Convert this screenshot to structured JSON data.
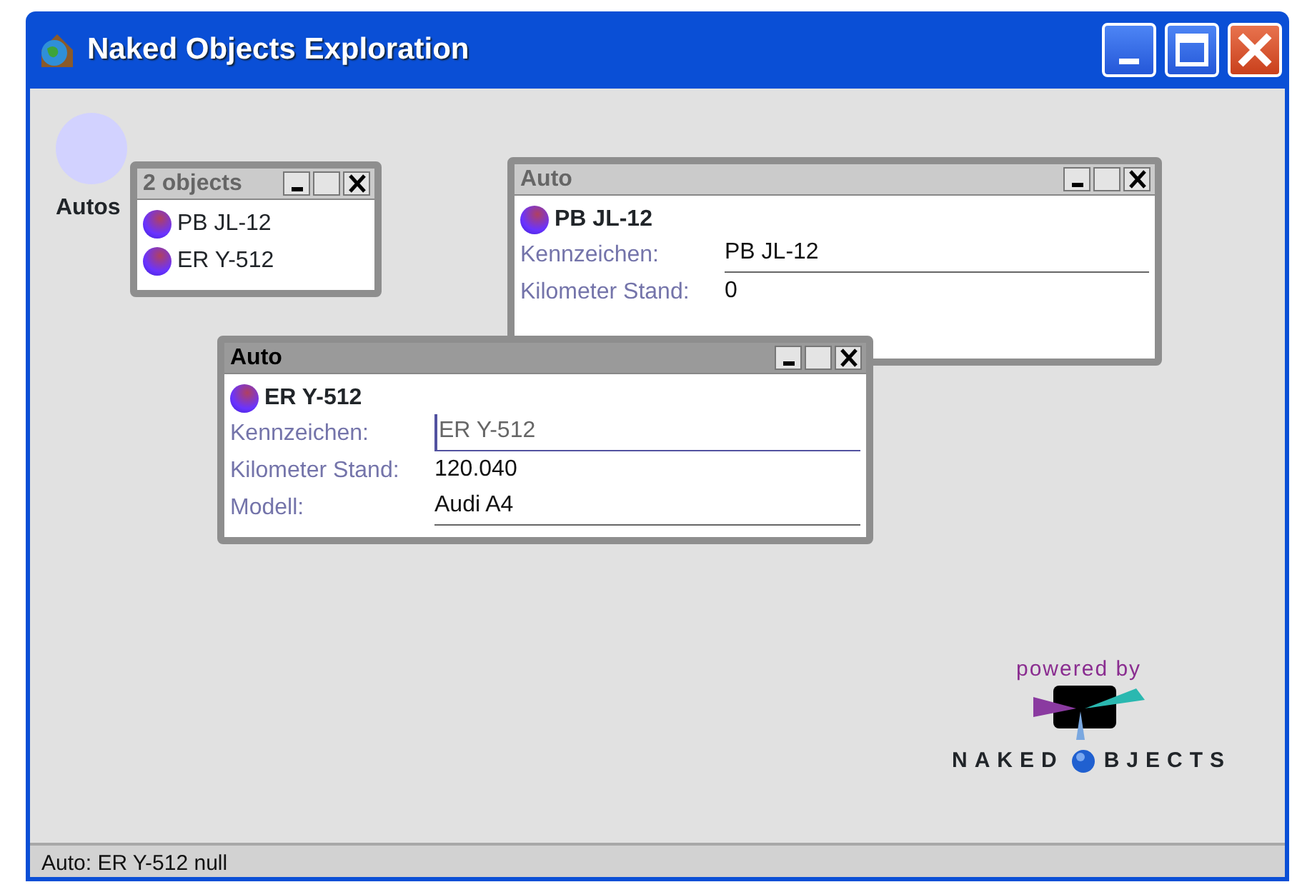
{
  "window": {
    "title": "Naked Objects Exploration"
  },
  "desktop_icon": {
    "label": "Autos"
  },
  "collection_window": {
    "title": "2 objects",
    "active": false,
    "items": [
      {
        "label": "PB JL-12"
      },
      {
        "label": "ER Y-512"
      }
    ]
  },
  "object_windows": [
    {
      "title": "Auto",
      "active": false,
      "heading": "PB JL-12",
      "fields": [
        {
          "label": "Kennzeichen:",
          "value": "PB JL-12",
          "kind": "text",
          "editing": false
        },
        {
          "label": "Kilometer Stand:",
          "value": "0",
          "kind": "number",
          "editing": false
        }
      ]
    },
    {
      "title": "Auto",
      "active": true,
      "heading": "ER Y-512",
      "fields": [
        {
          "label": "Kennzeichen:",
          "value": "ER Y-512",
          "kind": "text",
          "editing": true
        },
        {
          "label": "Kilometer Stand:",
          "value": "120.040",
          "kind": "number",
          "editing": false
        },
        {
          "label": "Modell:",
          "value": "Audi A4",
          "kind": "text",
          "editing": false
        }
      ]
    }
  ],
  "logo": {
    "tagline": "powered by",
    "wordmark_left": "NAKED",
    "wordmark_right": "BJECTS"
  },
  "status_bar": {
    "text": "Auto: ER Y-512 null"
  }
}
